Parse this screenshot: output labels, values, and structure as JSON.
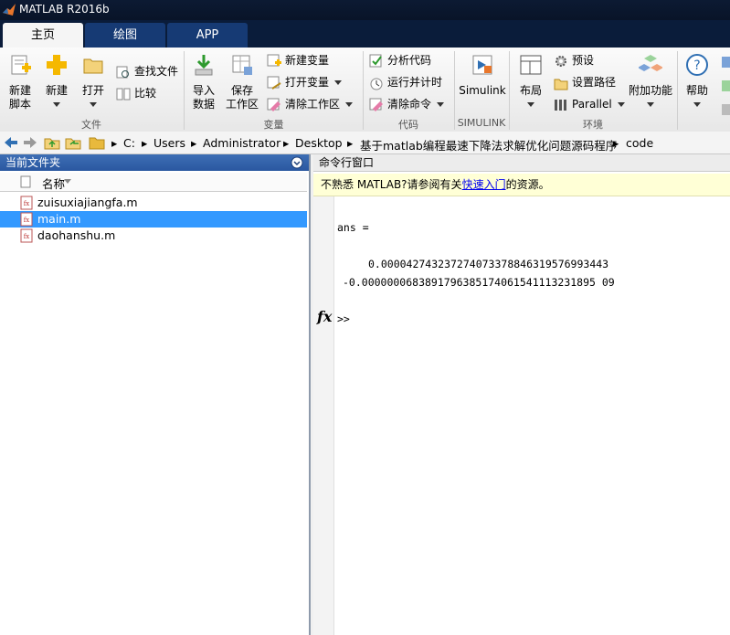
{
  "window": {
    "title": "MATLAB R2016b"
  },
  "tabs": [
    {
      "label": "主页"
    },
    {
      "label": "绘图"
    },
    {
      "label": "APP"
    }
  ],
  "ribbon": {
    "file": {
      "group_label": "文件",
      "new_script": "新建\n脚本",
      "new": "新建",
      "open": "打开",
      "find_files": "查找文件",
      "compare": "比较"
    },
    "variable": {
      "group_label": "变量",
      "import": "导入\n数据",
      "save_ws": "保存\n工作区",
      "new_var": "新建变量",
      "open_var": "打开变量",
      "clear_ws": "清除工作区"
    },
    "code": {
      "group_label": "代码",
      "analyze": "分析代码",
      "run_time": "运行并计时",
      "clear_cmd": "清除命令"
    },
    "simulink": {
      "group_label": "SIMULINK",
      "label": "Simulink"
    },
    "env": {
      "group_label": "环境",
      "layout": "布局",
      "prefs": "预设",
      "set_path": "设置路径",
      "parallel": "Parallel",
      "addons": "附加功能"
    },
    "resources": {
      "help": "帮助"
    }
  },
  "address": {
    "path": [
      "C:",
      "Users",
      "Administrator",
      "Desktop",
      "基于matlab编程最速下降法求解优化问题源码程序",
      "code"
    ]
  },
  "current_folder": {
    "title": "当前文件夹",
    "column_name": "名称",
    "files": [
      {
        "name": "zuisuxiajiangfa.m",
        "selected": false
      },
      {
        "name": "main.m",
        "selected": true
      },
      {
        "name": "daohanshu.m",
        "selected": false
      }
    ]
  },
  "command_window": {
    "title": "命令行窗口",
    "notice_prefix": "不熟悉 MATLAB?请参阅有关",
    "notice_link": "快速入门",
    "notice_suffix": "的资源。",
    "output_label": "ans =",
    "values": [
      "0.000042743237274073378846319576993443",
      "-0.0000000683891796385174061541113231895 09"
    ],
    "prompt": ">>",
    "fx_label": "fx"
  },
  "colors": {
    "accent": "#3399ff",
    "tabbar": "#0a1c3a",
    "notice_bg": "#ffffd6",
    "header": "#2a57a0"
  }
}
